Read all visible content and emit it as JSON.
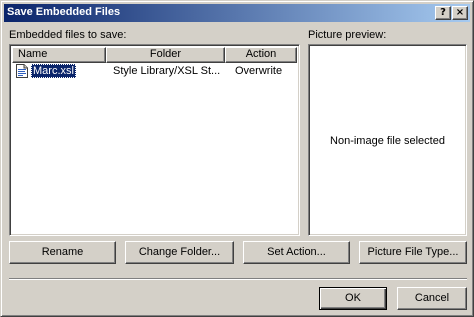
{
  "window": {
    "title": "Save Embedded Files",
    "help_glyph": "?",
    "close_glyph": "×"
  },
  "embedded": {
    "label": "Embedded files to save:",
    "columns": {
      "name": "Name",
      "folder": "Folder",
      "action": "Action"
    },
    "rows": [
      {
        "name": "Marc.xsl",
        "folder": "Style Library/XSL St...",
        "action": "Overwrite",
        "selected": true,
        "icon": "xsl-file-icon"
      }
    ]
  },
  "preview": {
    "label": "Picture preview:",
    "message": "Non-image file selected"
  },
  "buttons": {
    "rename": "Rename",
    "change_folder": "Change Folder...",
    "set_action": "Set Action...",
    "picture_file_type": "Picture File Type...",
    "ok": "OK",
    "cancel": "Cancel"
  },
  "colors": {
    "face": "#d4d0c8",
    "title_start": "#0a246a",
    "title_end": "#a6caf0",
    "selection": "#0a246a"
  }
}
